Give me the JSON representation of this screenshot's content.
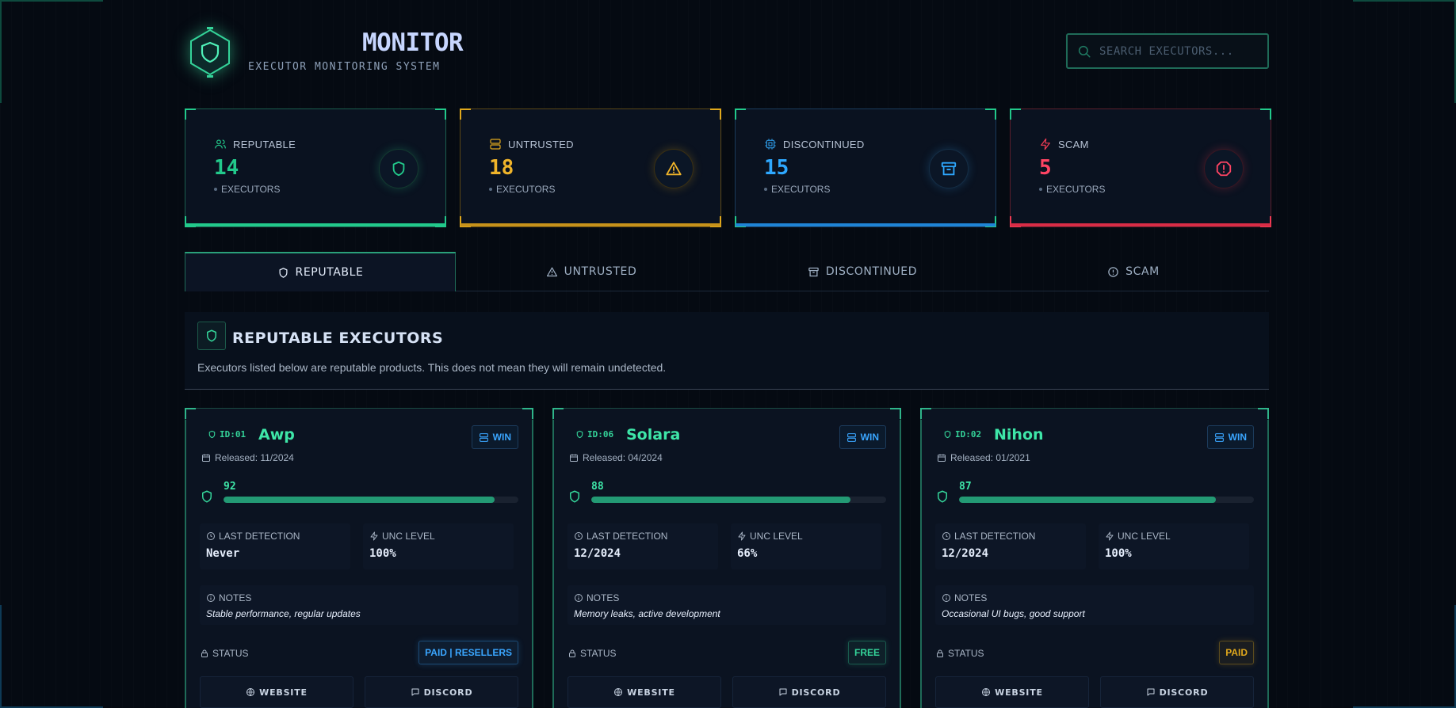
{
  "header": {
    "title": "MONITOR",
    "subtitle": "EXECUTOR MONITORING SYSTEM",
    "search_placeholder": "SEARCH EXECUTORS..."
  },
  "stats": [
    {
      "label": "REPUTABLE",
      "value": "14",
      "sub": "EXECUTORS",
      "color": "#22c98b",
      "icon": "shield-icon",
      "label_icon": "users-icon"
    },
    {
      "label": "UNTRUSTED",
      "value": "18",
      "sub": "EXECUTORS",
      "color": "#e0a81c",
      "icon": "warning-icon",
      "label_icon": "server-icon"
    },
    {
      "label": "DISCONTINUED",
      "value": "15",
      "sub": "EXECUTORS",
      "color": "#2e9be6",
      "icon": "archive-icon",
      "label_icon": "cpu-icon"
    },
    {
      "label": "SCAM",
      "value": "5",
      "sub": "EXECUTORS",
      "color": "#ef3b54",
      "icon": "alert-octagon-icon",
      "label_icon": "zap-icon"
    }
  ],
  "tabs": [
    {
      "label": "REPUTABLE",
      "icon": "shield-icon",
      "active": true
    },
    {
      "label": "UNTRUSTED",
      "icon": "warning-icon",
      "active": false
    },
    {
      "label": "DISCONTINUED",
      "icon": "archive-icon",
      "active": false
    },
    {
      "label": "SCAM",
      "icon": "alert-circle-icon",
      "active": false
    }
  ],
  "section": {
    "title": "REPUTABLE EXECUTORS",
    "description": "Executors listed below are reputable products. This does not mean they will remain undetected."
  },
  "cards": [
    {
      "id": "ID:01",
      "name": "Awp",
      "platform": "WIN",
      "released": "Released: 11/2024",
      "score": "92",
      "score_value": 92,
      "last_detection_label": "LAST DETECTION",
      "last_detection": "Never",
      "unc_label": "UNC LEVEL",
      "unc": "100%",
      "notes_label": "NOTES",
      "notes": "Stable performance, regular updates",
      "status_label": "STATUS",
      "status": "PAID | RESELLERS",
      "status_color": "#3aa6ff",
      "website_label": "WEBSITE",
      "discord_label": "DISCORD"
    },
    {
      "id": "ID:06",
      "name": "Solara",
      "platform": "WIN",
      "released": "Released: 04/2024",
      "score": "88",
      "score_value": 88,
      "last_detection_label": "LAST DETECTION",
      "last_detection": "12/2024",
      "unc_label": "UNC LEVEL",
      "unc": "66%",
      "notes_label": "NOTES",
      "notes": "Memory leaks, active development",
      "status_label": "STATUS",
      "status": "FREE",
      "status_color": "#34d399",
      "website_label": "WEBSITE",
      "discord_label": "DISCORD"
    },
    {
      "id": "ID:02",
      "name": "Nihon",
      "platform": "WIN",
      "released": "Released: 01/2021",
      "score": "87",
      "score_value": 87,
      "last_detection_label": "LAST DETECTION",
      "last_detection": "12/2024",
      "unc_label": "UNC LEVEL",
      "unc": "100%",
      "notes_label": "NOTES",
      "notes": "Occasional UI bugs, good support",
      "status_label": "STATUS",
      "status": "PAID",
      "status_color": "#e0a81c",
      "website_label": "WEBSITE",
      "discord_label": "DISCORD"
    }
  ]
}
